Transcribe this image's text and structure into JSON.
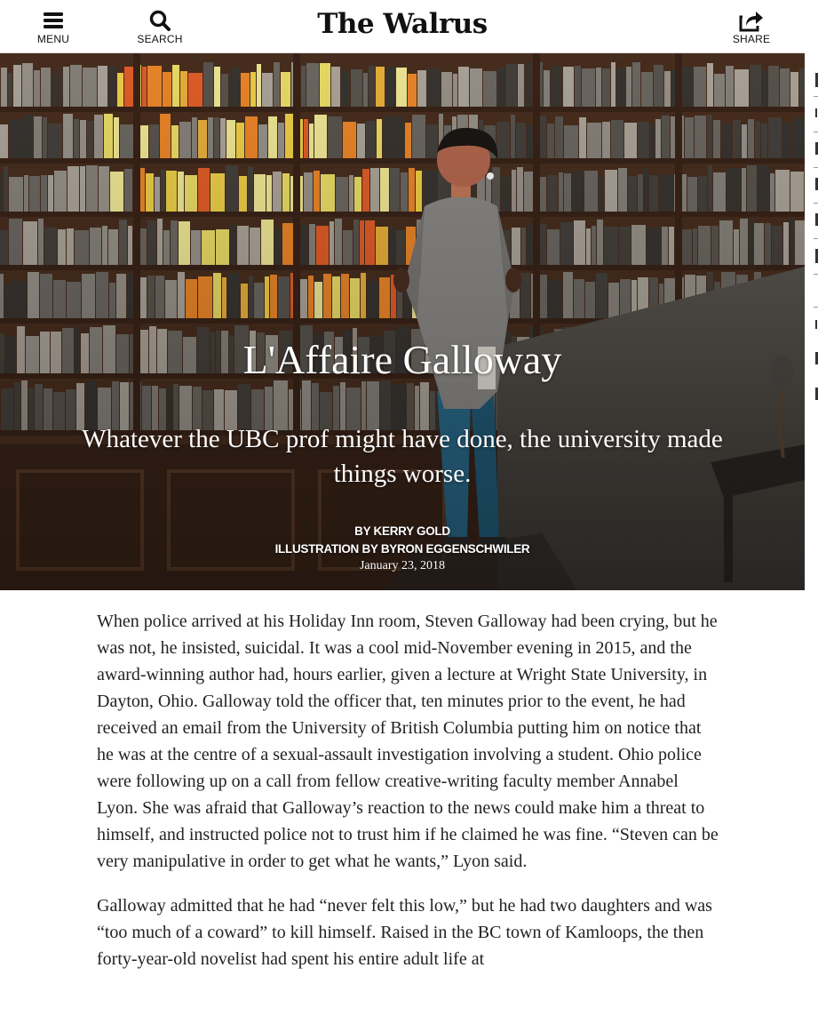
{
  "header": {
    "menu_label": "MENU",
    "search_label": "SEARCH",
    "brand": "The Walrus",
    "share_label": "SHARE",
    "icons": {
      "menu": "hamburger-icon",
      "search": "search-icon",
      "share": "share-icon"
    }
  },
  "article": {
    "title": "L'Affaire Galloway",
    "dek": "Whatever the UBC prof might have done, the university made things worse.",
    "byline_prefix": "BY ",
    "author": "KERRY GOLD",
    "illustration_prefix": "ILLUSTRATION BY ",
    "illustrator": "BYRON EGGENSCHWILER",
    "date": "January 23, 2018",
    "paragraphs": [
      "When police arrived at his Holiday Inn room, Steven Galloway had been crying, but he was not, he insisted, suicidal. It was a cool mid-November evening in 2015, and the award-winning author had, hours earlier, given a lecture at Wright State University, in Dayton, Ohio. Galloway told the officer that, ten minutes prior to the event, he had received an email from the University of British Columbia putting him on notice that he was at the centre of a sexual-assault investigation involving a student. Ohio police were following up on a call from fellow creative-writing faculty member Annabel Lyon. She was afraid that Galloway’s reaction to the news could make him a threat to himself, and instructed police not to trust him if he claimed he was fine. “Steven can be very manipulative in order to get what he wants,” Lyon said.",
      "Galloway admitted that he had “never felt this low,” but he had two daughters and was “too much of a coward” to kill himself. Raised in the BC town of Kamloops, the then forty-year-old novelist had spent his entire adult life at"
    ]
  },
  "colors": {
    "background": "#ffffff",
    "text": "#222222",
    "hero_text": "#ffffff",
    "shelf_wood": "#4a2f1f",
    "glow_yellow": "#f2e36a",
    "glow_orange": "#f28a2a"
  }
}
